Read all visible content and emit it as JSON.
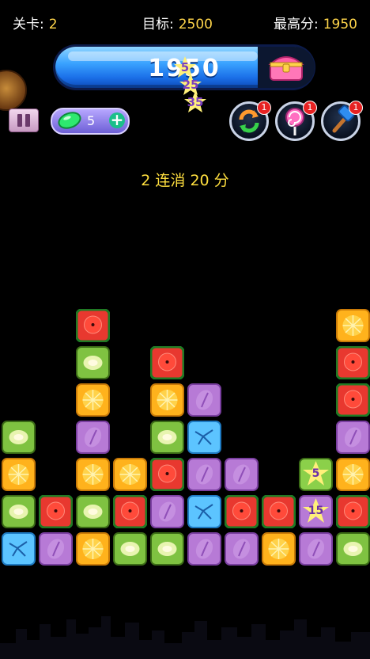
{
  "topbar": {
    "level_label": "关卡:",
    "level_value": "2",
    "target_label": "目标:",
    "target_value": "2500",
    "best_label": "最高分:",
    "best_value": "1950"
  },
  "score": {
    "value": "1950"
  },
  "floating_points": [
    "5",
    "25",
    "35"
  ],
  "gems": {
    "count": "5",
    "plus": "+"
  },
  "powerups": [
    {
      "name": "refresh",
      "badge": "1"
    },
    {
      "name": "lollipop",
      "badge": "1"
    },
    {
      "name": "hammer",
      "badge": "1"
    }
  ],
  "combo_text": "2 连消 20 分",
  "bonus_tiles": [
    {
      "value": "5"
    },
    {
      "value": "15"
    }
  ],
  "colors": {
    "kiwi": "#8bd04a",
    "watermelon": "#e8382f",
    "orange": "#ffb21c",
    "grape": "#b77ad6",
    "ice": "#5cc4ff",
    "score_accent": "#ffd54a"
  },
  "board": {
    "rows": 7,
    "cols": 10,
    "grid": [
      [
        "",
        "",
        "watermelon",
        "",
        "",
        "",
        "",
        "",
        "",
        "orange"
      ],
      [
        "",
        "",
        "kiwi",
        "",
        "watermelon",
        "",
        "",
        "",
        "",
        "watermelon"
      ],
      [
        "",
        "",
        "orange",
        "",
        "orange",
        "grape",
        "",
        "",
        "",
        "watermelon"
      ],
      [
        "kiwi",
        "",
        "grape",
        "",
        "kiwi",
        "ice",
        "",
        "",
        "",
        "grape"
      ],
      [
        "orange",
        "",
        "orange",
        "orange",
        "watermelon",
        "grape",
        "grape",
        "",
        "star5",
        "orange"
      ],
      [
        "kiwi",
        "watermelon",
        "kiwi",
        "watermelon",
        "grape",
        "ice",
        "watermelon",
        "watermelon",
        "star15",
        "watermelon"
      ],
      [
        "ice",
        "grape",
        "orange",
        "kiwi",
        "kiwi",
        "grape",
        "grape",
        "orange",
        "grape",
        "kiwi"
      ]
    ]
  }
}
